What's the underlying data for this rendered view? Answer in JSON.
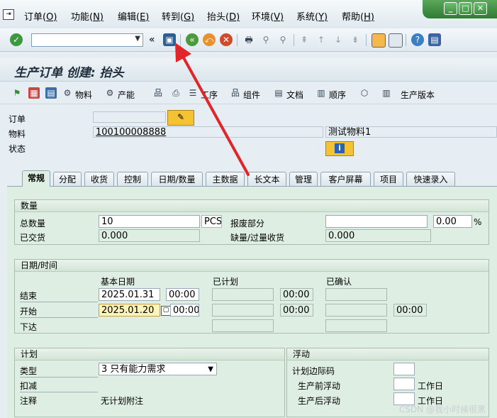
{
  "menu": {
    "items": [
      {
        "label": "订单(",
        "key": "O",
        "end": ")"
      },
      {
        "label": "功能(",
        "key": "N",
        "end": ")"
      },
      {
        "label": "编辑(",
        "key": "E",
        "end": ")"
      },
      {
        "label": "转到(",
        "key": "G",
        "end": ")"
      },
      {
        "label": "抬头(",
        "key": "D",
        "end": ")"
      },
      {
        "label": "环境(",
        "key": "V",
        "end": ")"
      },
      {
        "label": "系统(",
        "key": "Y",
        "end": ")"
      },
      {
        "label": "帮助(",
        "key": "H",
        "end": ")"
      }
    ]
  },
  "title": "生产订单 创建: 抬头",
  "app_toolbar": {
    "material": "物料",
    "capacity": "产能",
    "operation": "工序",
    "component": "组件",
    "document": "文档",
    "sequence": "顺序",
    "production_version": "生产版本"
  },
  "header": {
    "order_label": "订单",
    "order_value": "",
    "material_label": "物料",
    "material_value": "100100008888",
    "material_desc": "测试物料1",
    "status_label": "状态",
    "info_icon": "i"
  },
  "tabs": [
    {
      "label": "常规",
      "active": true
    },
    {
      "label": "分配"
    },
    {
      "label": "收货"
    },
    {
      "label": "控制"
    },
    {
      "label": "日期/数量"
    },
    {
      "label": "主数据"
    },
    {
      "label": "长文本"
    },
    {
      "label": "管理"
    },
    {
      "label": "客户屏幕"
    },
    {
      "label": "项目"
    },
    {
      "label": "快速录入"
    }
  ],
  "quantity": {
    "group_title": "数量",
    "total_label": "总数量",
    "total_value": "10",
    "unit": "PCS",
    "scrap_label": "报废部分",
    "scrap_value": "",
    "scrap_pct": "0.00",
    "pct_sign": "%",
    "delivered_label": "已交货",
    "delivered_value": "0.000",
    "short_label": "缺量/过量收货",
    "short_value": "0.000"
  },
  "dates": {
    "group_title": "日期/时间",
    "col_basic": "基本日期",
    "col_scheduled": "已计划",
    "col_confirmed": "已确认",
    "finish_label": "结束",
    "finish_date": "2025.01.31",
    "finish_time": "00:00",
    "finish_sched_time": "00:00",
    "start_label": "开始",
    "start_date": "2025.01.20",
    "start_time": "00:00",
    "start_sched_time": "00:00",
    "start_conf_time": "00:00",
    "release_label": "下达"
  },
  "planning": {
    "group_title": "计划",
    "type_label": "类型",
    "type_value": "3 只有能力需求",
    "reduction_label": "扣减",
    "note_label": "注释",
    "note_value": "无计划附注"
  },
  "float": {
    "group_title": "浮动",
    "sm_label": "计划边际码",
    "before_label": "生产前浮动",
    "after_label": "生产后浮动",
    "workday": "工作日"
  },
  "watermark": "CSDN @我小时候很黑",
  "colors": {
    "accent_green": "#2f7c33",
    "arrow_red": "#e0262b",
    "tab_bg": "#dfeee3"
  }
}
